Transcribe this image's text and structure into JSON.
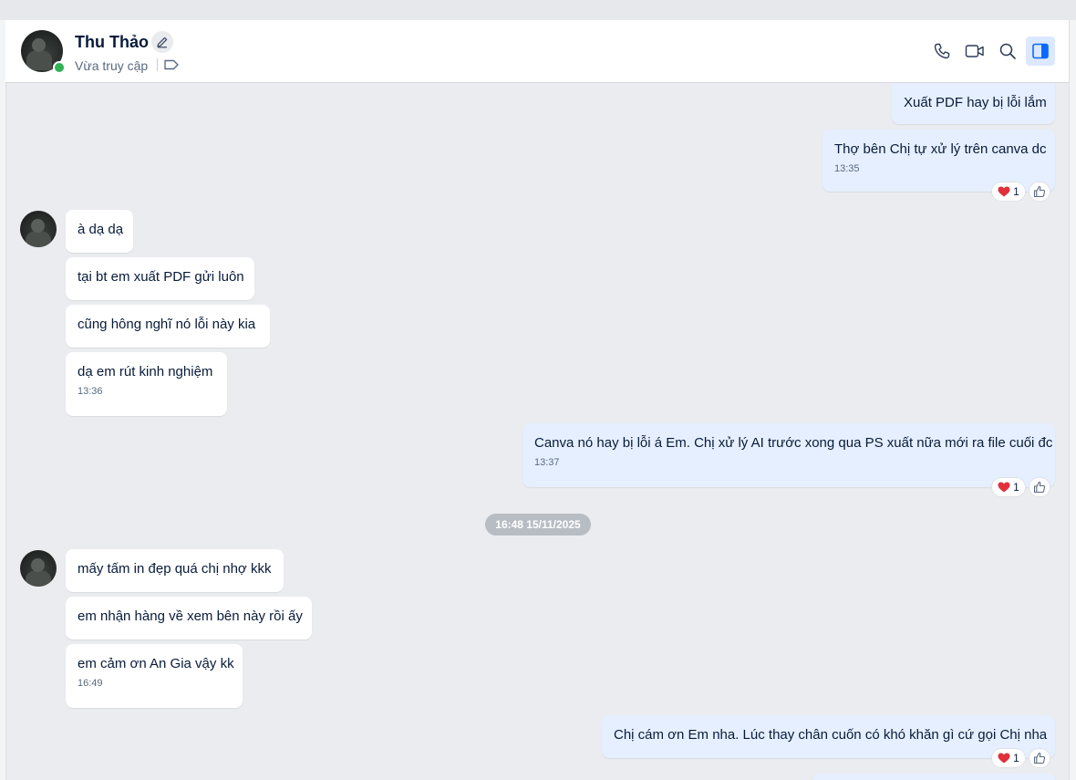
{
  "header": {
    "name": "Thu Thảo",
    "status": "Vừa truy cập",
    "icons": [
      "phone-icon",
      "video-call-icon",
      "search-icon",
      "sidebar-toggle-icon"
    ]
  },
  "colors": {
    "online": "#2fb154",
    "outgoing_bubble": "#e5efff",
    "incoming_bubble": "#ffffff",
    "heart": "#e0303c"
  },
  "messages": {
    "out1": "Xuất PDF hay bị lỗi lắm",
    "out2": "Thợ bên Chị tự xử lý trên canva dc",
    "out2_time": "13:35",
    "in1": "à dạ dạ",
    "in2": "tại bt em xuất PDF gửi luôn",
    "in3": "cũng hông nghĩ nó lỗi này kia",
    "in4": "dạ em rút kinh nghiệm",
    "in4_time": "13:36",
    "out3": "Canva nó hay bị lỗi á Em. Chị xử lý AI trước xong qua PS xuất nữa mới ra file cuối đc",
    "out3_time": "13:37",
    "date_divider": "16:48 15/11/2025",
    "in5": "mấy tấm in đẹp quá chị nhợ kkk",
    "in6": "em nhận hàng về xem bên này rồi ấy",
    "in7": "em cảm ơn An Gia vậy kk",
    "in7_time": "16:49",
    "out4": "Chị cám ơn Em nha. Lúc thay chân cuốn có khó khăn gì cứ gọi Chị nha"
  },
  "reactions": {
    "heart_count": "1"
  }
}
